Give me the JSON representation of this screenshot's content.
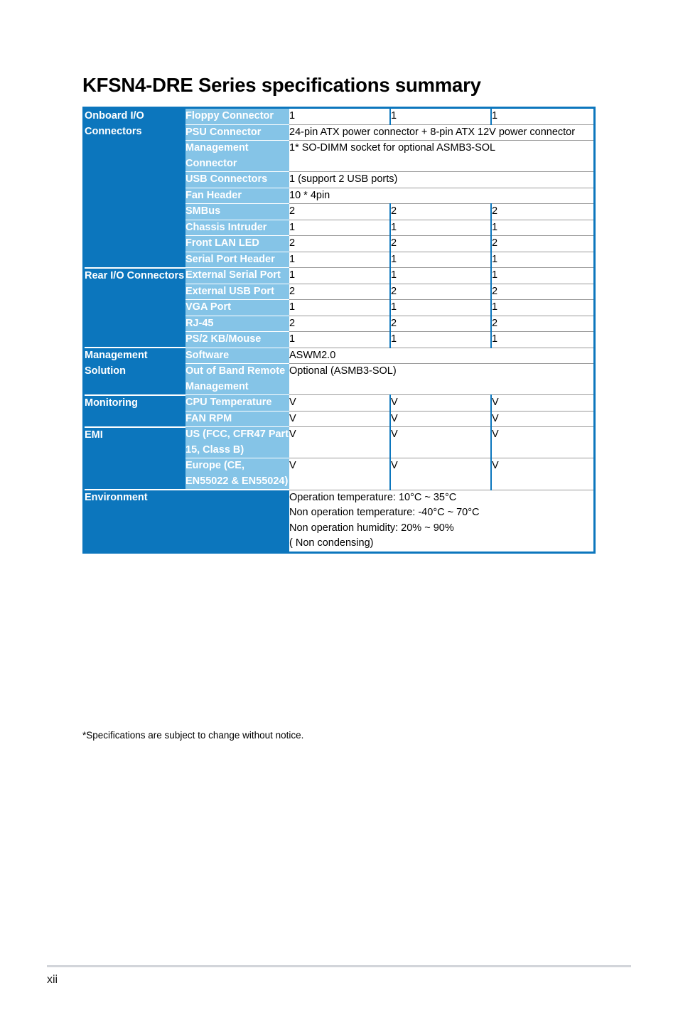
{
  "document": {
    "title": "KFSN4-DRE Series specifications summary",
    "footnote": "*Specifications are subject to change without notice.",
    "page_number": "xii",
    "colors": {
      "group_blue": "#0c76bd",
      "label_blue": "#85c4e7",
      "row_rule_gray": "#9a9a9a",
      "footer_rule_gray": "#d2d5da"
    }
  },
  "table": {
    "sections": [
      {
        "group": "Onboard I/O Connectors",
        "rows": [
          {
            "label": "Floppy Connector",
            "split": true,
            "values": [
              "1",
              "1",
              "1"
            ]
          },
          {
            "label": "PSU Connector",
            "split": false,
            "values": [
              "24-pin ATX power connector + 8-pin ATX 12V power connector"
            ]
          },
          {
            "label": "Management Connector",
            "split": false,
            "values": [
              "1* SO-DIMM socket for optional ASMB3-SOL"
            ]
          },
          {
            "label": "USB Connectors",
            "split": false,
            "values": [
              "1 (support 2 USB ports)"
            ]
          },
          {
            "label": "Fan Header",
            "split": false,
            "values": [
              "10 * 4pin"
            ]
          },
          {
            "label": "SMBus",
            "split": true,
            "values": [
              "2",
              "2",
              "2"
            ]
          },
          {
            "label": "Chassis Intruder",
            "split": true,
            "values": [
              "1",
              "1",
              "1"
            ]
          },
          {
            "label": "Front LAN LED",
            "split": true,
            "values": [
              "2",
              "2",
              "2"
            ]
          },
          {
            "label": "Serial Port Header",
            "split": true,
            "values": [
              "1",
              "1",
              "1"
            ]
          }
        ]
      },
      {
        "group": "Rear I/O Connectors",
        "rows": [
          {
            "label": "External Serial Port",
            "split": true,
            "values": [
              "1",
              "1",
              "1"
            ]
          },
          {
            "label": "External USB Port",
            "split": true,
            "values": [
              "2",
              "2",
              "2"
            ]
          },
          {
            "label": "VGA Port",
            "split": true,
            "values": [
              "1",
              "1",
              "1"
            ]
          },
          {
            "label": "RJ-45",
            "split": true,
            "values": [
              "2",
              "2",
              "2"
            ]
          },
          {
            "label": "PS/2 KB/Mouse",
            "split": true,
            "values": [
              "1",
              "1",
              "1"
            ]
          }
        ]
      },
      {
        "group": "Management Solution",
        "rows": [
          {
            "label": "Software",
            "split": false,
            "values": [
              "ASWM2.0"
            ]
          },
          {
            "label": "Out of Band Remote Management",
            "split": false,
            "values": [
              "Optional (ASMB3-SOL)"
            ]
          }
        ]
      },
      {
        "group": "Monitoring",
        "rows": [
          {
            "label": "CPU Temperature",
            "split": true,
            "values": [
              "V",
              "V",
              "V"
            ]
          },
          {
            "label": "FAN RPM",
            "split": true,
            "values": [
              "V",
              "V",
              "V"
            ]
          }
        ]
      },
      {
        "group": "EMI",
        "rows": [
          {
            "label": "US (FCC, CFR47 Part 15, Class B)",
            "split": true,
            "values": [
              "V",
              "V",
              "V"
            ]
          },
          {
            "label": "Europe (CE, EN55022 & EN55024)",
            "split": true,
            "values": [
              "V",
              "V",
              "V"
            ]
          }
        ]
      }
    ],
    "environment": {
      "group": "Environment",
      "lines": [
        "Operation temperature: 10°C ~ 35°C",
        "Non operation temperature: -40°C ~ 70°C",
        "Non operation humidity: 20% ~ 90%",
        "( Non condensing)"
      ]
    }
  }
}
